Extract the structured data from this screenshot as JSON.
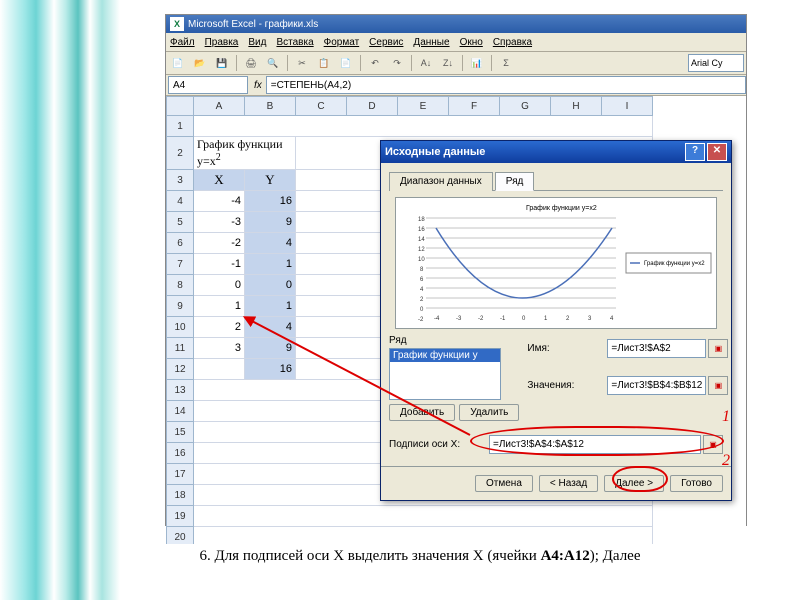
{
  "app_title": "Microsoft Excel - графики.xls",
  "menu": [
    "Файл",
    "Правка",
    "Вид",
    "Вставка",
    "Формат",
    "Сервис",
    "Данные",
    "Окно",
    "Справка"
  ],
  "font_name": "Arial Cy",
  "namebox": "A4",
  "formula": "=СТЕПЕНЬ(A4,2)",
  "col_headers": [
    "A",
    "B",
    "C",
    "D",
    "E",
    "F",
    "G",
    "H",
    "I"
  ],
  "title_cell": "График  функции y=x",
  "header_x": "X",
  "header_y": "Y",
  "rows": [
    {
      "x": "-4",
      "y": "16"
    },
    {
      "x": "-3",
      "y": "9"
    },
    {
      "x": "-2",
      "y": "4"
    },
    {
      "x": "-1",
      "y": "1"
    },
    {
      "x": "0",
      "y": "0"
    },
    {
      "x": "1",
      "y": "1"
    },
    {
      "x": "2",
      "y": "4"
    },
    {
      "x": "3",
      "y": "9"
    },
    {
      "x": "",
      "y": "16"
    }
  ],
  "dialog": {
    "title": "Исходные данные",
    "tab1": "Диапазон данных",
    "tab2": "Ряд",
    "chart_title": "График  функции y=x2",
    "legend_item": "График  функции y=x2",
    "section_row": "Ряд",
    "list_item": "График  функции y",
    "btn_add": "Добавить",
    "btn_del": "Удалить",
    "lbl_name": "Имя:",
    "val_name": "=Лист3!$A$2",
    "lbl_values": "Значения:",
    "val_values": "=Лист3!$B$4:$B$12",
    "lbl_xaxis": "Подписи оси X:",
    "val_xaxis": "=Лист3!$A$4:$A$12",
    "btn_cancel": "Отмена",
    "btn_back": "< Назад",
    "btn_next": "Далее >",
    "btn_finish": "Готово"
  },
  "annotation_1": "1",
  "annotation_2": "2",
  "chart_data": {
    "type": "line",
    "title": "График  функции y=x2",
    "x": [
      -4,
      -3,
      -2,
      -1,
      0,
      1,
      2,
      3,
      4
    ],
    "values": [
      16,
      9,
      4,
      1,
      0,
      1,
      4,
      9,
      16
    ],
    "ylim": [
      -2,
      18
    ],
    "y_ticks": [
      -2,
      0,
      2,
      4,
      6,
      8,
      10,
      12,
      14,
      16,
      18
    ],
    "legend": [
      "График  функции y=x2"
    ]
  },
  "caption_prefix": "6. Для подписей оси X выделить значения X (ячейки ",
  "caption_bold": "А4:А12",
  "caption_suffix": "); Далее"
}
